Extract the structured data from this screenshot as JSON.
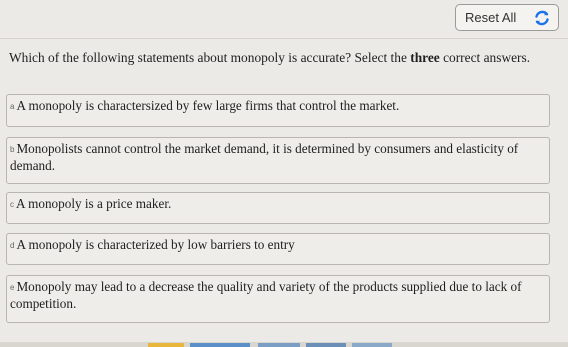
{
  "toolbar": {
    "reset_label": "Reset All",
    "reset_icon": "refresh-icon",
    "accent_color": "#1a73e8"
  },
  "question": {
    "prefix": "Which of the following statements about monopoly is accurate? Select the ",
    "emphasis": "three",
    "suffix": " correct answers."
  },
  "options": [
    {
      "letter": "a",
      "text": "A monopoly is charactersized by few large firms that control the market."
    },
    {
      "letter": "b",
      "text": "Monopolists cannot control the market demand, it is determined by consumers and elasticity of demand."
    },
    {
      "letter": "c",
      "text": "A monopoly is a price maker."
    },
    {
      "letter": "d",
      "text": "A monopoly is characterized by low barriers to entry"
    },
    {
      "letter": "e",
      "text": "Monopoly may lead to a decrease the quality and variety of the products supplied due to lack of competition."
    }
  ]
}
